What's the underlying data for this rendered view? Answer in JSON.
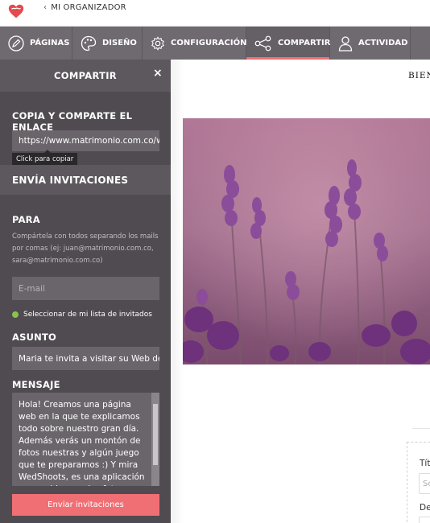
{
  "topbar": {
    "back_label": "MI ORGANIZADOR"
  },
  "nav": {
    "items": [
      {
        "label": "PÁGINAS",
        "icon": "pencil-icon"
      },
      {
        "label": "DISEÑO",
        "icon": "palette-icon"
      },
      {
        "label": "CONFIGURACIÓN",
        "icon": "gear-icon"
      },
      {
        "label": "COMPARTIR",
        "icon": "share-icon",
        "active": true
      },
      {
        "label": "ACTIVIDAD",
        "icon": "user-icon"
      }
    ],
    "active_color": "#f06f74"
  },
  "sidebar": {
    "title": "COMPARTIR",
    "close_glyph": "×",
    "copy_section_label": "COPIA Y COMPARTE EL ENLACE",
    "link_value": "https://www.matrimonio.com.co/web",
    "tooltip": "Click para copiar",
    "invite_section_title": "ENVÍA INVITACIONES",
    "to_label": "PARA",
    "to_help": "Compártela con todos separando los mails por comas (ej: juan@matrimonio.com.co, sara@matrimonio.com.co)",
    "email_placeholder": "E-mail",
    "guest_list_link": "Seleccionar de mi lista de invitados",
    "subject_label": "ASUNTO",
    "subject_value": "Maria te invita a visitar su Web de",
    "message_label": "MENSAJE",
    "message_value": "Hola! Creamos una página web en la que te explicamos todo sobre nuestro gran día. Además verás un montón de fotos nuestras y algún juego que te preparamos :) Y mira WedShoots, es una aplicación para subir y ver las fotos",
    "send_button": "Enviar invitaciones"
  },
  "preview": {
    "heading_fragment": "BIEN",
    "field1_label": "Tít",
    "field1_placeholder": "Sc",
    "field2_label": "De"
  }
}
